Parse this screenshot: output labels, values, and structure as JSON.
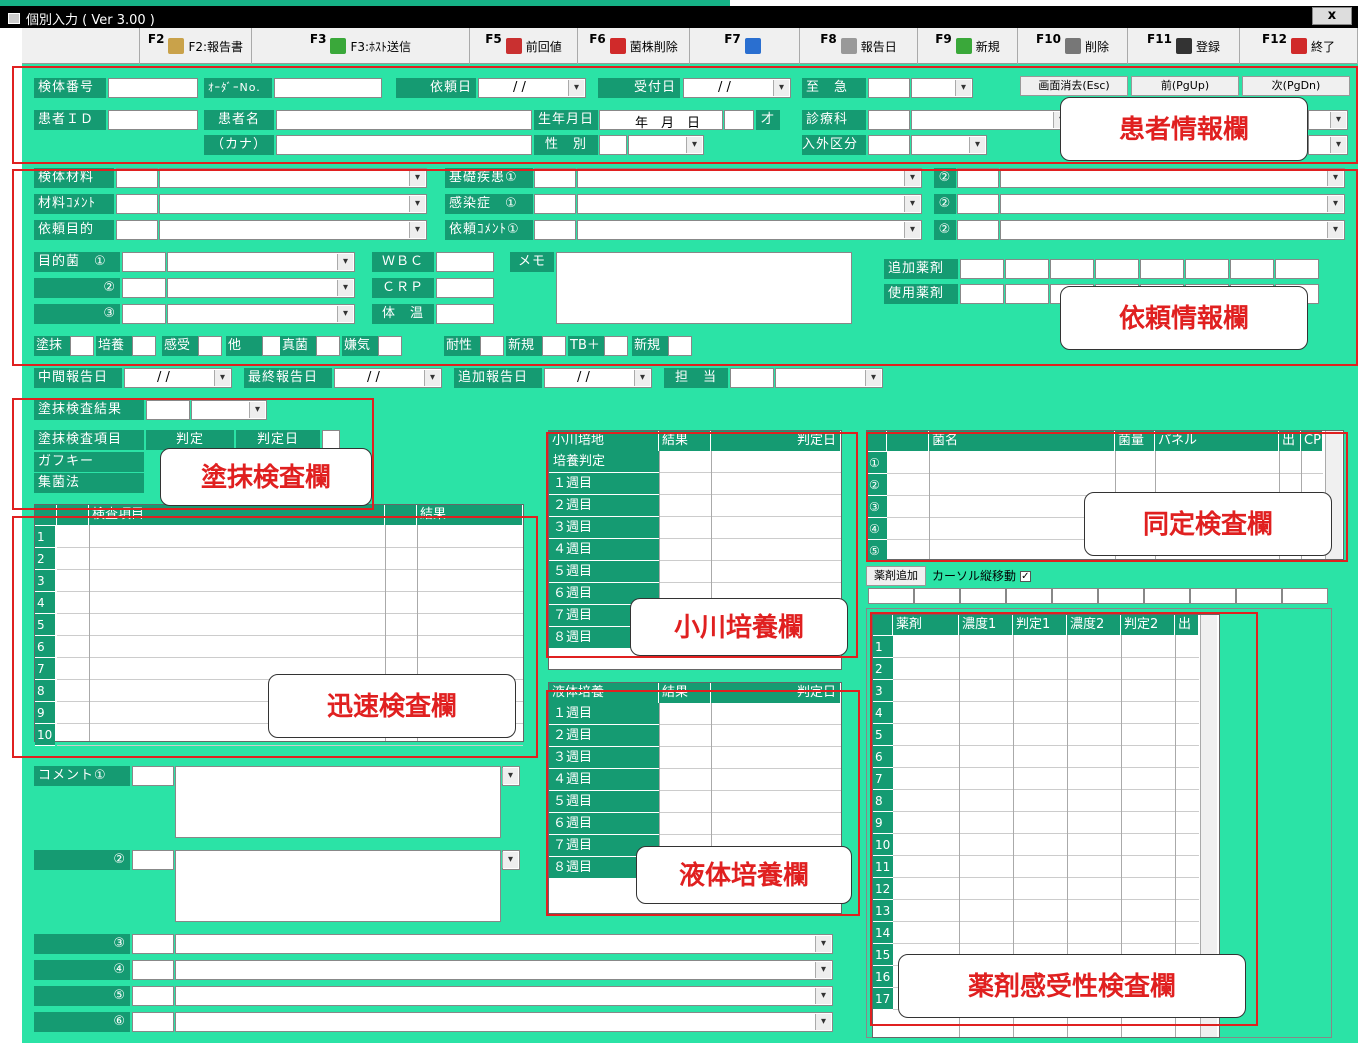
{
  "window": {
    "title": "個別入力 ( Ver 3.00 )",
    "close": "x"
  },
  "fkeys": [
    {
      "key": "F2",
      "label": "F2:報告書",
      "icon": "report-icon",
      "color": "#c9a24a"
    },
    {
      "key": "F3",
      "label": "F3:ﾎｽﾄ送信",
      "icon": "send-icon",
      "color": "#3aa83a"
    },
    {
      "key": "F5",
      "label": "前回値",
      "icon": "prev-icon",
      "color": "#c93030"
    },
    {
      "key": "F6",
      "label": "菌株削除",
      "icon": "delete-circle-icon",
      "color": "#d02a2a"
    },
    {
      "key": "F7",
      "label": "",
      "icon": "refresh-icon",
      "color": "#2a6fd0"
    },
    {
      "key": "F8",
      "label": "報告日",
      "icon": "calendar-icon",
      "color": "#999999"
    },
    {
      "key": "F9",
      "label": "新規",
      "icon": "new-icon",
      "color": "#3aa83a"
    },
    {
      "key": "F10",
      "label": "削除",
      "icon": "trash-icon",
      "color": "#777777"
    },
    {
      "key": "F11",
      "label": "登録",
      "icon": "register-icon",
      "color": "#333333"
    },
    {
      "key": "F12",
      "label": "終了",
      "icon": "power-icon",
      "color": "#d02a2a"
    }
  ],
  "nav": {
    "clear": "画面消去(Esc)",
    "prev": "前(PgUp)",
    "next": "次(PgDn)"
  },
  "patient": {
    "specimen_no": "検体番号",
    "order_no": "ｵｰﾀﾞｰNo.",
    "request_date": "依頼日",
    "request_date_value": "/   /",
    "reception_date": "受付日",
    "reception_date_value": "/   /",
    "urgent": "至　急",
    "patient_id": "患者ＩＤ",
    "patient_name": "患者名",
    "kana": "（カナ）",
    "birthdate": "生年月日",
    "birthdate_value": "年　月　日",
    "age_unit": "才",
    "sex": "性　別",
    "department": "診療科",
    "inout": "入外区分"
  },
  "request": {
    "material": "検体材料",
    "material_comment": "材料ｺﾒﾝﾄ",
    "purpose": "依頼目的",
    "disease": "基礎疾患①",
    "infection": "感染症　①",
    "req_comment": "依頼ｺﾒﾝﾄ①",
    "circ2": "②",
    "target_bact": "目的菌　①",
    "t2": "②",
    "t3": "③",
    "wbc": "ＷＢＣ",
    "crp": "ＣＲＰ",
    "temp": "体　温",
    "memo": "メモ",
    "add_drug": "追加薬剤",
    "use_drug": "使用薬剤",
    "flags": [
      "塗抹",
      "培養",
      "感受",
      "他",
      "真菌",
      "嫌気",
      "耐性",
      "新規",
      "TB＋",
      "新規"
    ],
    "mid_report": "中間報告日",
    "final_report": "最終報告日",
    "add_report": "追加報告日",
    "staff": "担　当",
    "date_blank": "/   /"
  },
  "smear": {
    "result": "塗抹検査結果",
    "item": "塗抹検査項目",
    "judge": "判定",
    "judge_date": "判定日",
    "rows": [
      "ガフキー",
      "集菌法"
    ]
  },
  "rapid": {
    "header_item": "検査項目",
    "header_result": "結果",
    "rows": [
      "1",
      "2",
      "3",
      "4",
      "5",
      "6",
      "7",
      "8",
      "9",
      "10"
    ]
  },
  "ogawa": {
    "h1": "小川培地",
    "h2": "結果",
    "h3": "判定日",
    "rows": [
      "培養判定",
      "１週目",
      "２週目",
      "３週目",
      "４週目",
      "５週目",
      "６週目",
      "７週目",
      "８週目"
    ]
  },
  "liquid": {
    "h1": "液体培養",
    "h2": "結果",
    "h3": "判定日",
    "rows": [
      "１週目",
      "２週目",
      "３週目",
      "４週目",
      "５週目",
      "６週目",
      "７週目",
      "８週目"
    ]
  },
  "ident": {
    "h_name": "菌名",
    "h_qty": "菌量",
    "h_panel": "パネル",
    "h_out": "出",
    "h_cp": "CP",
    "rows": [
      "①",
      "②",
      "③",
      "④",
      "⑤"
    ]
  },
  "drug": {
    "add_btn": "薬剤追加",
    "cursor": "カーソル縦移動",
    "cursor_check": "✓",
    "h_drug": "薬剤",
    "h_c1": "濃度1",
    "h_j1": "判定1",
    "h_c2": "濃度2",
    "h_j2": "判定2",
    "h_out": "出",
    "rows": [
      "1",
      "2",
      "3",
      "4",
      "5",
      "6",
      "7",
      "8",
      "9",
      "10",
      "11",
      "12",
      "13",
      "14",
      "15",
      "16",
      "17"
    ]
  },
  "comments": {
    "c1": "コメント①",
    "c2": "②",
    "c3": "③",
    "c4": "④",
    "c5": "⑤",
    "c6": "⑥"
  },
  "callouts": {
    "patient": "患者情報欄",
    "request": "依頼情報欄",
    "smear": "塗抹検査欄",
    "rapid": "迅速検査欄",
    "ogawa": "小川培養欄",
    "liquid": "液体培養欄",
    "ident": "同定検査欄",
    "drug": "薬剤感受性検査欄"
  }
}
